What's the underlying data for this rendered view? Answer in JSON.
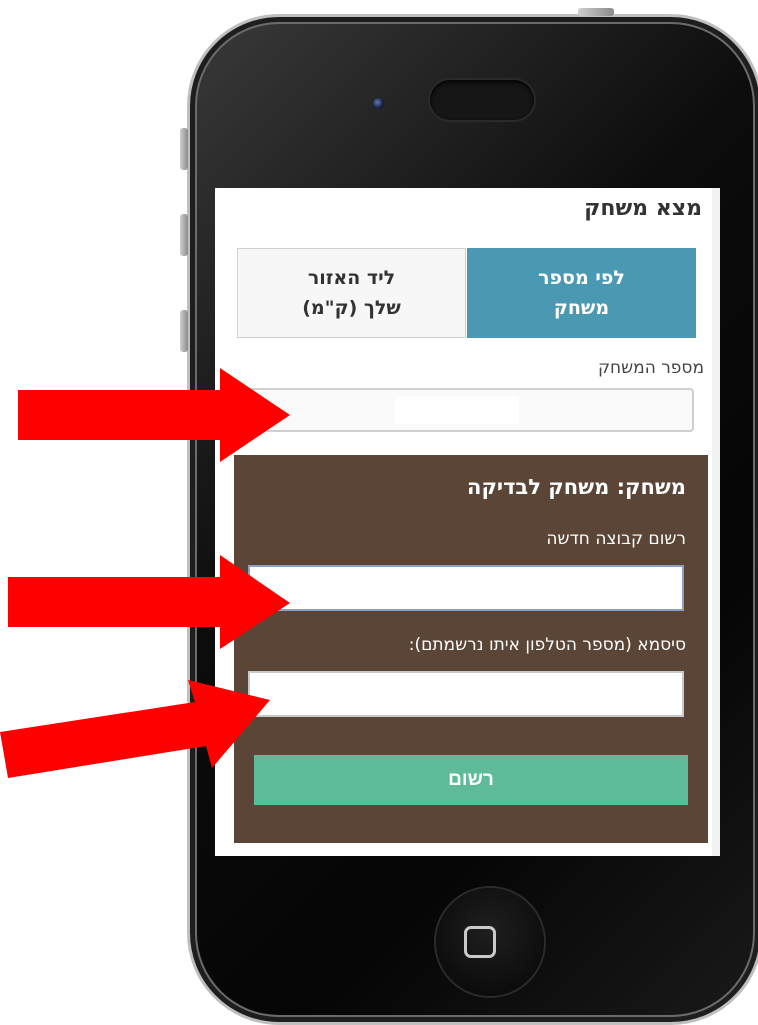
{
  "screen": {
    "title": "מצא משחק",
    "tabs": [
      {
        "label": "לפי מספר\nמשחק",
        "active": true
      },
      {
        "label": "ליד האזור\nשלך (ק\"מ)",
        "active": false
      }
    ],
    "game_number_label": "מספר המשחק",
    "game_number_value": "",
    "registration": {
      "game_title": "משחק: משחק לבדיקה",
      "group_label": "רשום קבוצה חדשה",
      "group_value": "",
      "password_label": "סיסמא (מספר הטלפון איתו נרשמתם):",
      "password_value": "",
      "submit_label": "רשום"
    }
  },
  "colors": {
    "active_tab": "#4b98b3",
    "panel_bg": "#5a4537",
    "submit_button": "#5ebb98",
    "arrow": "#ff0000"
  },
  "annotations": {
    "arrows": [
      "arrow-to-game-number",
      "arrow-to-group-name",
      "arrow-to-password"
    ]
  }
}
